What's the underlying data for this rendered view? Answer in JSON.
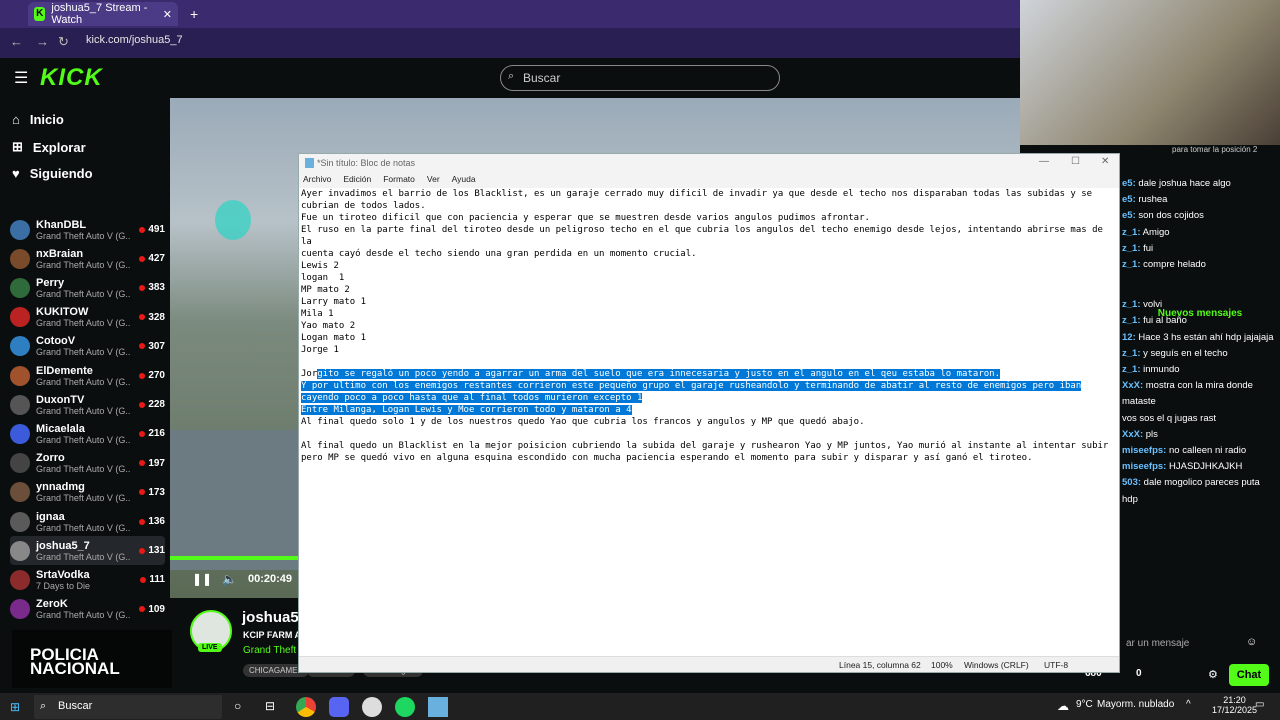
{
  "browser": {
    "tab_title": "joshua5_7 Stream - Watch",
    "url": "kick.com/joshua5_7"
  },
  "kick": {
    "logo": "KICK",
    "search_placeholder": "Buscar",
    "nav": [
      {
        "label": "Inicio",
        "icon": "home-icon"
      },
      {
        "label": "Explorar",
        "icon": "compass-icon"
      },
      {
        "label": "Siguiendo",
        "icon": "heart-icon"
      }
    ],
    "channels": [
      {
        "name": "KhanDBL",
        "game": "Grand Theft Auto V (G...",
        "viewers": "491",
        "color": "#3a6ea5"
      },
      {
        "name": "nxBraian",
        "game": "Grand Theft Auto V (G...",
        "viewers": "427",
        "color": "#7a4b2a"
      },
      {
        "name": "Perry",
        "game": "Grand Theft Auto V (G...",
        "viewers": "383",
        "color": "#2f6b3a"
      },
      {
        "name": "KUKITOW",
        "game": "Grand Theft Auto V (G...",
        "viewers": "328",
        "color": "#b22"
      },
      {
        "name": "CotooV",
        "game": "Grand Theft Auto V (G...",
        "viewers": "307",
        "color": "#2d7fc1"
      },
      {
        "name": "ElDemente",
        "game": "Grand Theft Auto V (G...",
        "viewers": "270",
        "color": "#a0522d"
      },
      {
        "name": "DuxonTV",
        "game": "Grand Theft Auto V (G...",
        "viewers": "228",
        "color": "#555"
      },
      {
        "name": "Micaelala",
        "game": "Grand Theft Auto V (G...",
        "viewers": "216",
        "color": "#3b5bdb"
      },
      {
        "name": "Zorro",
        "game": "Grand Theft Auto V (G...",
        "viewers": "197",
        "color": "#444"
      },
      {
        "name": "ynnadmg",
        "game": "Grand Theft Auto V (G...",
        "viewers": "173",
        "color": "#6b4f3a"
      },
      {
        "name": "ignaa",
        "game": "Grand Theft Auto V (G...",
        "viewers": "136",
        "color": "#5a5a5a"
      },
      {
        "name": "joshua5_7",
        "game": "Grand Theft Auto V (G...",
        "viewers": "131",
        "color": "#888"
      },
      {
        "name": "SrtaVodka",
        "game": "7 Days to Die",
        "viewers": "111",
        "color": "#8b2b2b"
      },
      {
        "name": "ZeroK",
        "game": "Grand Theft Auto V (G...",
        "viewers": "109",
        "color": "#7a2a8a"
      }
    ]
  },
  "stream": {
    "time": "00:20:49",
    "streamer": "joshua5_",
    "title": "KCIP FARM A",
    "game": "Grand Theft",
    "live": "LIVE",
    "tags": [
      "CHICAGAMER",
      "Sevenaire",
      "valentinagmo"
    ],
    "overlay_line1": "POLICIA",
    "overlay_line2": "NACIONAL"
  },
  "chat": {
    "lines": [
      {
        "user": "e5:",
        "text": "dale joshua hace algo"
      },
      {
        "user": "e5:",
        "text": "rushea"
      },
      {
        "user": "e5:",
        "text": "son dos cojidos"
      },
      {
        "user": "z_1:",
        "text": "Amigo"
      },
      {
        "user": "z_1:",
        "text": "fui"
      },
      {
        "user": "z_1:",
        "text": "compre helado"
      },
      {
        "user": "z_1:",
        "text": "volvi"
      },
      {
        "user": "z_1:",
        "text": "fui al baño"
      },
      {
        "user": "12:",
        "text": "Hace 3 hs están ahí hdp jajajaja"
      },
      {
        "user": "z_1:",
        "text": "y seguís en el techo"
      },
      {
        "user": "z_1:",
        "text": "inmundo"
      },
      {
        "user": "XxX:",
        "text": "mostra con la mira donde"
      },
      {
        "user": "",
        "text": "mataste"
      },
      {
        "user": "",
        "text": "vos sos el q jugas rast"
      },
      {
        "user": "XxX:",
        "text": "pls"
      },
      {
        "user": "miseefps:",
        "text": "no calleen ni radio"
      },
      {
        "user": "miseefps:",
        "text": "HJASDJHKAJKH"
      },
      {
        "user": "503:",
        "text": "dale mogolico pareces puta"
      },
      {
        "user": "",
        "text": "hdp"
      }
    ],
    "new_messages": "Nuevos mensajes",
    "pinned": "para tomar la posición 2",
    "input_placeholder": "ar un mensaje",
    "send": "Chat",
    "counter": "680",
    "counter2": "0"
  },
  "notepad": {
    "title": "*Sin título: Bloc de notas",
    "menu": [
      "Archivo",
      "Edición",
      "Formato",
      "Ver",
      "Ayuda"
    ],
    "text_before": "Ayer invadimos el barrio de los Blacklist, es un garaje cerrado muy dificil de invadir ya que desde el techo nos disparaban todas las subidas y se\ncubrian de todos lados.\nFue un tiroteo dificil que con paciencia y esperar que se muestren desde varios angulos pudimos afrontar.\nEl ruso en la parte final del tiroteo desde un peligroso techo en el que cubria los angulos del techo enemigo desde lejos, intentando abrirse mas de la\ncuenta cayó desde el techo siendo una gran perdida en un momento crucial.\nLewis 2\nlogan  1\nMP mato 2\nLarry mato 1\nMila 1\nYao mato 2\nLogan mato 1\nJorge 1\n\nJor",
    "text_selected": "gito se regaló un poco yendo a agarrar un arma del suelo que era innecesaria y justo en el angulo en el qeu estaba lo mataron.\nY por ultimo con los enemigos restantes corrieron este pequeño grupo el garaje rusheandolo y terminando de abatir al resto de enemigos pero iban\ncayendo poco a poco hasta que al final todos murieron excepto 1\nEntre Milanga, Logan Lewis y Moe corrieron todo y mataron a 4",
    "text_after": "\nAl final quedo solo 1 y de los nuestros quedo Yao que cubria los francos y angulos y MP que quedó abajo.\n\nAl final quedo un Blacklist en la mejor poisicion cubriendo la subida del garaje y rushearon Yao y MP juntos, Yao murió al instante al intentar subir\npero MP se quedó vivo en alguna esquina escondido con mucha paciencia esperando el momento para subir y disparar y así ganó el tiroteo.",
    "status": {
      "position": "Línea 15, columna 62",
      "zoom": "100%",
      "eol": "Windows (CRLF)",
      "encoding": "UTF-8"
    }
  },
  "taskbar": {
    "search": "Buscar",
    "weather": "9°C",
    "weather_desc": "Mayorm. nublado",
    "time": "21:20",
    "date": "17/12/2025"
  }
}
